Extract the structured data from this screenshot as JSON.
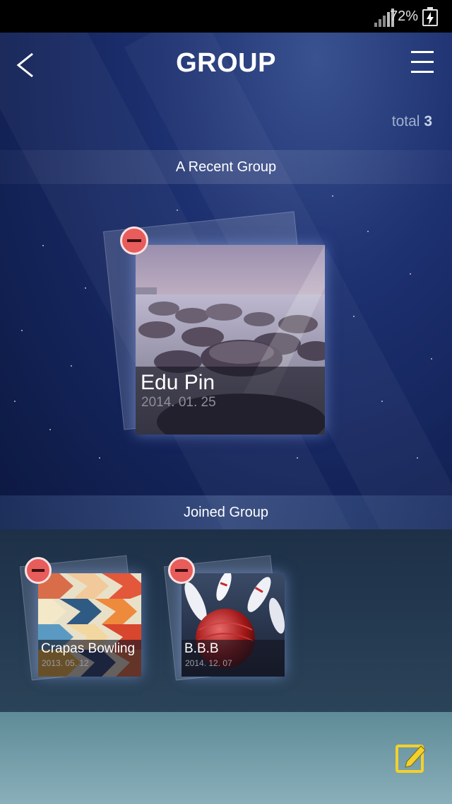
{
  "status_bar": {
    "battery": "72%"
  },
  "header": {
    "title": "GROUP"
  },
  "total": {
    "label": "total",
    "count": "3"
  },
  "sections": {
    "recent": "A Recent Group",
    "joined": "Joined Group"
  },
  "recent_group": {
    "name": "Edu Pin",
    "date": "2014. 01. 25"
  },
  "joined_groups": [
    {
      "name": "Crapas Bowling",
      "date": "2013. 05. 12"
    },
    {
      "name": "B.B.B",
      "date": "2014. 12. 07"
    }
  ],
  "colors": {
    "remove": "#e85c5c",
    "edit": "#f3d02c",
    "accent": "#1d3070"
  },
  "icons": {
    "back": "back-chevron-icon",
    "menu": "hamburger-menu-icon",
    "remove": "remove-minus-icon",
    "edit": "edit-note-icon"
  }
}
